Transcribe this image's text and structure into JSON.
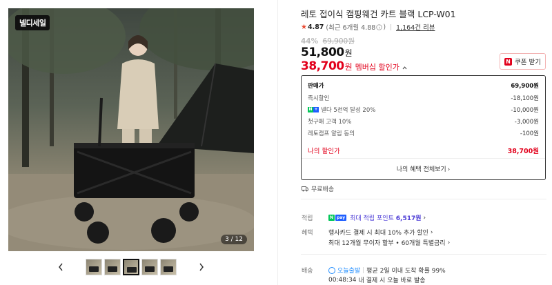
{
  "gallery": {
    "badge": "넬디세일",
    "counter": "3 / 12",
    "prev_label": "previous",
    "next_label": "next"
  },
  "product": {
    "title": "레토 접이식 캠핑웨건 카트 블랙 LCP-W01",
    "rating": "4.87",
    "rating_recent": "(최근 6개월 4.88",
    "rating_recent_close": ")",
    "reviews": "1,164건 리뷰",
    "discount_pct": "44%",
    "original_price": "69,900원",
    "sale_price": "51,800",
    "sale_unit": "원",
    "member_price": "38,700",
    "member_unit": "원",
    "member_label": "멤버십 할인가"
  },
  "coupon": {
    "icon_text": "N",
    "label": "쿠폰 받기"
  },
  "breakdown": {
    "rows": [
      {
        "label": "판매가",
        "value": "69,900원"
      },
      {
        "label": "즉시할인",
        "value": "-18,100원"
      },
      {
        "label": "넬다 5천억 달성 20%",
        "value": "-10,000원"
      },
      {
        "label": "첫구매 고객 10%",
        "value": "-3,000원"
      },
      {
        "label": "레토캠프 알림 동의",
        "value": "-100원"
      }
    ],
    "total_label": "나의 할인가",
    "total_value": "38,700원",
    "all_benefits": "나의 혜택 전체보기",
    "chevron": "›"
  },
  "shipping": {
    "label": "무료배송"
  },
  "details": {
    "points_label": "적립",
    "points_text": "최대 적립 포인트",
    "points_amount": "6,517원",
    "benefit_label": "혜택",
    "benefit_line1": "행사카드 결제 시 최대 10% 추가 할인",
    "benefit_line2": "최대 12개월 무이자 할부 • 60개월 특별금리",
    "delivery_label": "배송",
    "delivery_express": "오늘출발",
    "delivery_text": "평균 2일 이내 도착 확률 99%",
    "delivery_time": "00:48:34",
    "delivery_time_text": "내 결제 시 오늘 바로 발송",
    "chevron": "›",
    "pay_badge_n": "N",
    "pay_badge_pay": "pay",
    "sep": "|"
  },
  "colors": {
    "accent_red": "#e2001b",
    "points_purple": "#4b3bd6",
    "express_blue": "#1e8cff",
    "naver_green": "#03c75a"
  }
}
